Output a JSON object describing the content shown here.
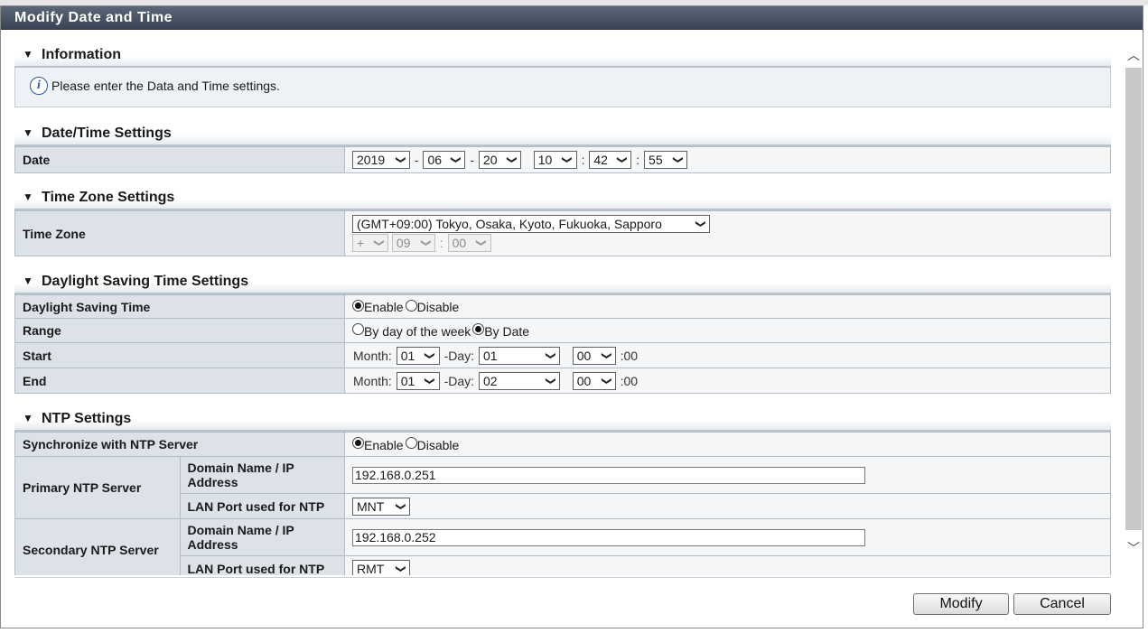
{
  "dialog": {
    "title": "Modify Date and Time"
  },
  "information": {
    "header": "Information",
    "message": "Please enter the Data and Time settings."
  },
  "datetime": {
    "header": "Date/Time Settings",
    "date_label": "Date",
    "year": "2019",
    "month": "06",
    "day": "20",
    "hour": "10",
    "minute": "42",
    "second": "55",
    "sep_dash": "-",
    "sep_colon": ":"
  },
  "timezone": {
    "header": "Time Zone Settings",
    "label": "Time Zone",
    "zone": "(GMT+09:00) Tokyo, Osaka, Kyoto, Fukuoka, Sapporo",
    "offset_sign": "+",
    "offset_hour": "09",
    "offset_minute": "00"
  },
  "dst": {
    "header": "Daylight Saving Time Settings",
    "dst_label": "Daylight Saving Time",
    "enable": "Enable",
    "disable": "Disable",
    "range_label": "Range",
    "range_week": "By day of the week",
    "range_date": "By Date",
    "start_label": "Start",
    "end_label": "End",
    "month_text": "Month:",
    "day_text": "-Day:",
    "colon_zero": ":00",
    "start_month": "01",
    "start_day": "01",
    "start_hour": "00",
    "end_month": "01",
    "end_day": "02",
    "end_hour": "00"
  },
  "ntp": {
    "header": "NTP Settings",
    "sync_label": "Synchronize with NTP Server",
    "enable": "Enable",
    "disable": "Disable",
    "primary_label": "Primary NTP Server",
    "secondary_label": "Secondary NTP Server",
    "domain_label": "Domain Name / IP Address",
    "lan_label": "LAN Port used for NTP",
    "primary_address": "192.168.0.251",
    "primary_port": "MNT",
    "secondary_address": "192.168.0.252",
    "secondary_port": "RMT"
  },
  "buttons": {
    "modify": "Modify",
    "cancel": "Cancel"
  },
  "icons": {
    "collapse": "triangle-down-icon",
    "info": "info-icon",
    "dropdown": "chevron-down-icon"
  }
}
